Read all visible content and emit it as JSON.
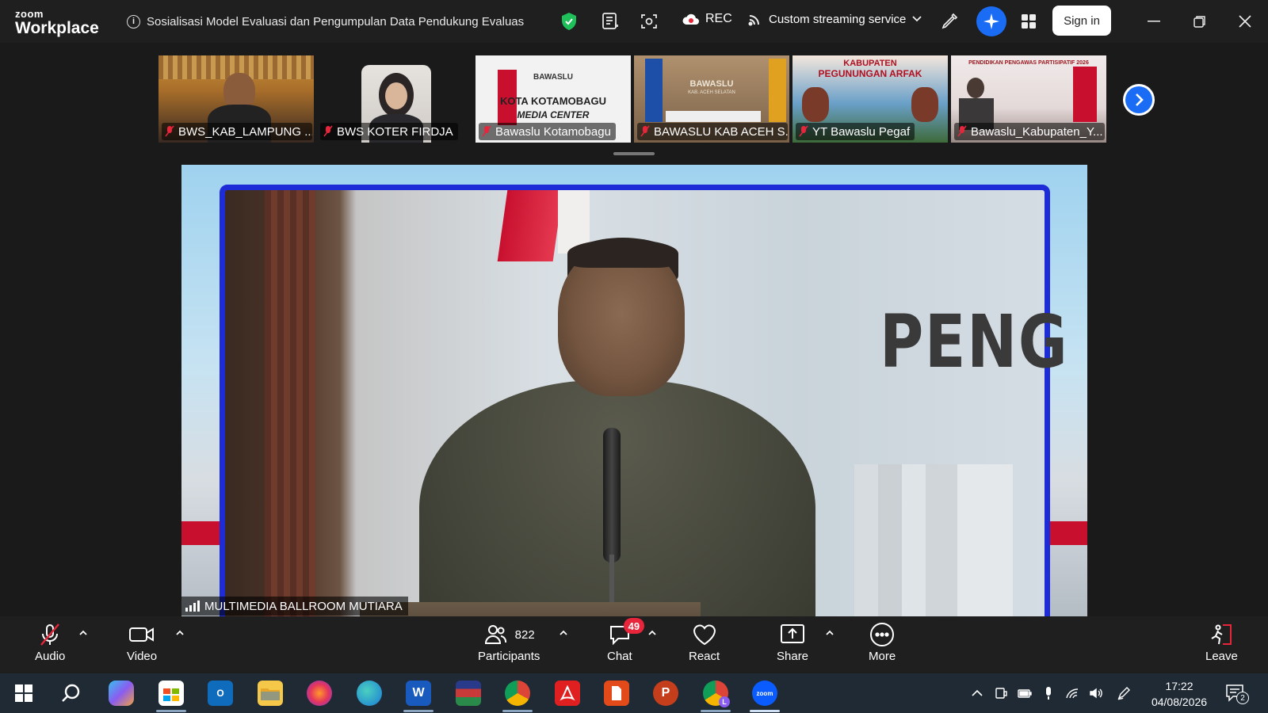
{
  "app": {
    "brand_top": "zoom",
    "brand_bottom": "Workplace"
  },
  "meeting": {
    "title": "Sosialisasi Model Evaluasi dan Pengumpulan Data Pendukung Evaluasi IKI"
  },
  "titlebar": {
    "rec_label": "REC",
    "stream_label": "Custom streaming service",
    "signin_label": "Sign in",
    "accent_color": "#1a6cf5",
    "shield_color": "#1fbf5a"
  },
  "gallery": {
    "tiles": [
      {
        "name": "BWS_KAB_LAMPUNG ..."
      },
      {
        "name": "BWS KOTER FIRDJA"
      },
      {
        "name": "Bawaslu Kotamobagu"
      },
      {
        "name": "BAWASLU KAB ACEH S..."
      },
      {
        "name": "YT Bawaslu Pegaf"
      },
      {
        "name": "Bawaslu_Kabupaten_Y..."
      }
    ],
    "tile_texts": {
      "bawaslu": "BAWASLU",
      "kota": "KOTA KOTAMOBAGU",
      "media_center": "MEDIA CENTER",
      "bawaslu_kab": "BAWASLU",
      "kab_sub": "KAB. ACEH SELATAN",
      "kabupaten": "KABUPATEN",
      "pegunungan": "PEGUNUNGAN ARFAK",
      "pendidikan": "PENDIDIKAN PENGAWAS PARTISIPATIF 2026"
    }
  },
  "main_video": {
    "speaker_label": "MULTIMEDIA BALLROOM MUTIARA",
    "banner_text": "PENG"
  },
  "controls": {
    "audio_label": "Audio",
    "video_label": "Video",
    "participants_label": "Participants",
    "participants_count": "822",
    "chat_label": "Chat",
    "chat_badge": "49",
    "react_label": "React",
    "share_label": "Share",
    "more_label": "More",
    "leave_label": "Leave",
    "leave_color": "#e8253a"
  },
  "taskbar": {
    "time": "17:22",
    "date": "04/08/2026",
    "notification_count": "2",
    "word_label": "W",
    "zoom_label": "zoom",
    "ppt_label": "P",
    "chrome_badge": "L"
  }
}
